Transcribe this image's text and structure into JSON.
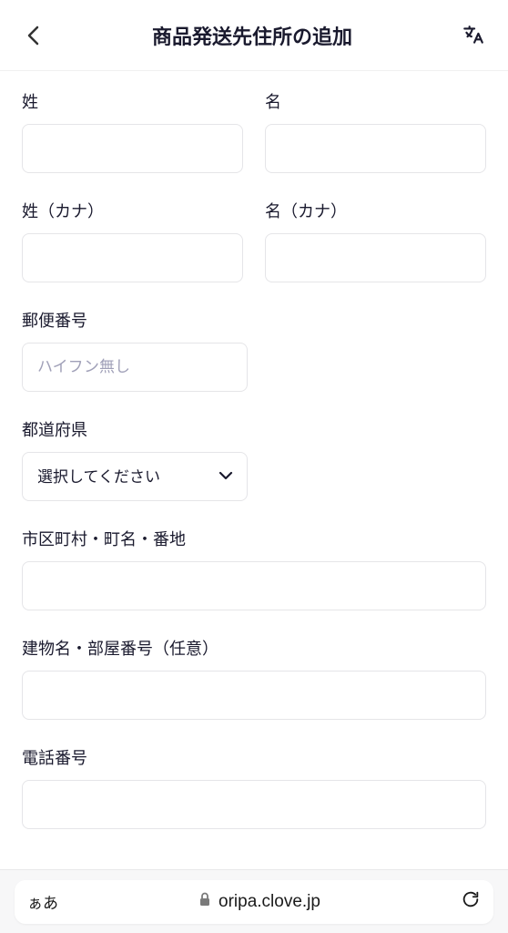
{
  "header": {
    "title": "商品発送先住所の追加"
  },
  "form": {
    "lastName": {
      "label": "姓",
      "value": ""
    },
    "firstName": {
      "label": "名",
      "value": ""
    },
    "lastNameKana": {
      "label": "姓（カナ）",
      "value": ""
    },
    "firstNameKana": {
      "label": "名（カナ）",
      "value": ""
    },
    "postalCode": {
      "label": "郵便番号",
      "placeholder": "ハイフン無し",
      "value": ""
    },
    "prefecture": {
      "label": "都道府県",
      "placeholder": "選択してください",
      "value": ""
    },
    "cityAddress": {
      "label": "市区町村・町名・番地",
      "value": ""
    },
    "building": {
      "label": "建物名・部屋番号（任意）",
      "value": ""
    },
    "phone": {
      "label": "電話番号",
      "value": ""
    }
  },
  "browser": {
    "aa": "ぁあ",
    "url": "oripa.clove.jp"
  }
}
